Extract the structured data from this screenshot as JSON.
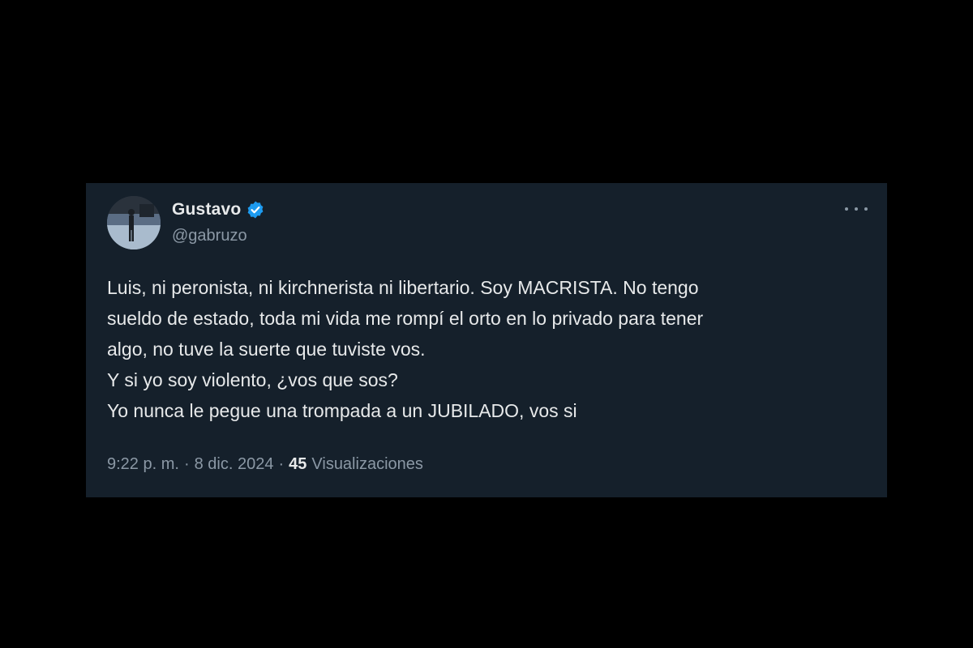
{
  "tweet": {
    "display_name": "Gustavo",
    "handle": "@gabruzo",
    "verified": true,
    "verified_color": "#1d9bf0",
    "text_lines": [
      "Luis, ni peronista, ni kirchnerista ni libertario.  Soy MACRISTA.  No tengo",
      "sueldo de estado, toda mi vida me rompí el orto en lo privado para tener",
      "algo, no tuve la suerte que tuviste vos.",
      "Y si yo soy violento, ¿vos que sos?",
      "Yo nunca le pegue una trompada a un JUBILADO, vos si"
    ],
    "time": "9:22 p. m.",
    "separator": "·",
    "date": "8 dic. 2024",
    "views_count": "45",
    "views_label": "Visualizaciones"
  },
  "icons": {
    "verified": "verified-badge-icon",
    "more": "more-options-icon"
  },
  "colors": {
    "page_background": "#000000",
    "card_background": "#15202b",
    "primary_text": "#e7e9ea",
    "secondary_text": "#8b98a5"
  }
}
